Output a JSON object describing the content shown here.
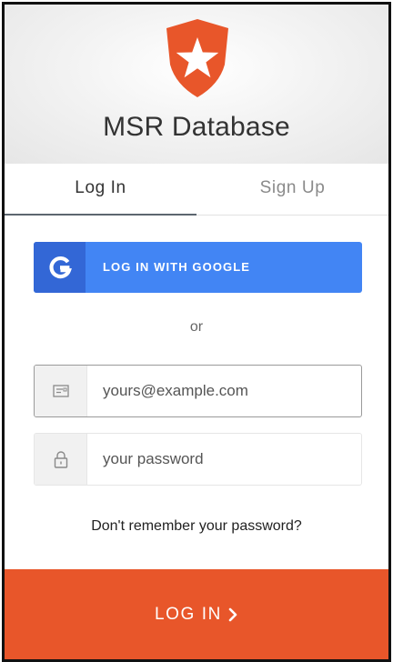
{
  "header": {
    "title": "MSR Database",
    "logo_icon": "auth0-shield-star-icon",
    "logo_color": "#e8562a"
  },
  "tabs": [
    {
      "label": "Log In",
      "active": true
    },
    {
      "label": "Sign Up",
      "active": false
    }
  ],
  "social": {
    "google_label": "LOG IN WITH GOOGLE",
    "google_icon": "google-g-icon",
    "google_color": "#4285f4"
  },
  "separator": "or",
  "form": {
    "email": {
      "value": "",
      "placeholder": "yours@example.com",
      "icon": "envelope-icon"
    },
    "password": {
      "value": "",
      "placeholder": "your password",
      "icon": "lock-icon"
    }
  },
  "forgot_link": "Don't remember your password?",
  "submit": {
    "label": "LOG IN",
    "icon": "chevron-right-icon",
    "color": "#e8562a"
  }
}
